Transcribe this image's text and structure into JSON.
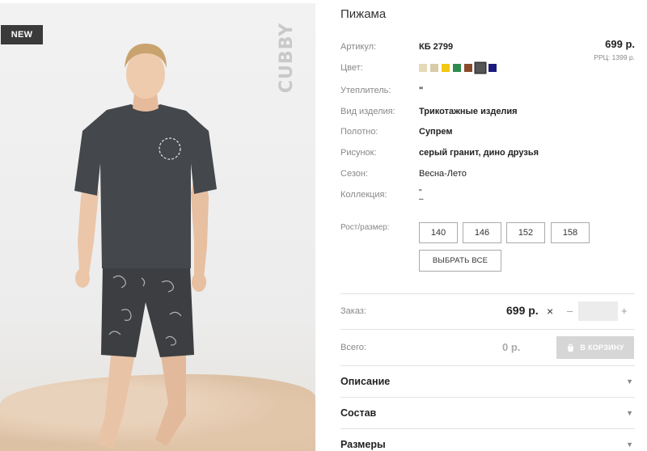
{
  "photo": {
    "badge": "NEW",
    "brand": "CUBBY"
  },
  "product": {
    "title": "Пижама",
    "price": "699 р.",
    "rrp": "РРЦ: 1399 р."
  },
  "attributes": [
    {
      "label": "Артикул:",
      "value": "КБ 2799"
    },
    {
      "label": "Цвет:",
      "value": ""
    },
    {
      "label": "Утеплитель:",
      "value": "\""
    },
    {
      "label": "Вид изделия:",
      "value": "Трикотажные изделия"
    },
    {
      "label": "Полотно:",
      "value": "Супрем"
    },
    {
      "label": "Рисунок:",
      "value": "серый гранит, дино друзья"
    },
    {
      "label": "Сезон:",
      "value": "Весна-Лето"
    },
    {
      "label": "Коллекция:",
      "value": "\"\n–"
    }
  ],
  "colors": [
    {
      "hex": "#e6d9b8",
      "selected": false
    },
    {
      "hex": "#d8cba8",
      "selected": false
    },
    {
      "hex": "#f2c811",
      "selected": false
    },
    {
      "hex": "#2e8b4e",
      "selected": false
    },
    {
      "hex": "#8b4a2c",
      "selected": false
    },
    {
      "hex": "#555555",
      "selected": true
    },
    {
      "hex": "#1a1a7a",
      "selected": false
    }
  ],
  "sizes": {
    "label": "Рост/размер:",
    "options": [
      "140",
      "146",
      "152",
      "158"
    ],
    "select_all": "ВЫБРАТЬ ВСЕ"
  },
  "order": {
    "label": "Заказ:",
    "price": "699 р.",
    "times": "×",
    "minus": "–",
    "plus": "+",
    "quantity": ""
  },
  "total": {
    "label": "Всего:",
    "value": "0 р.",
    "cart_button": "В КОРЗИНУ"
  },
  "accordion": [
    "Описание",
    "Состав",
    "Размеры"
  ]
}
